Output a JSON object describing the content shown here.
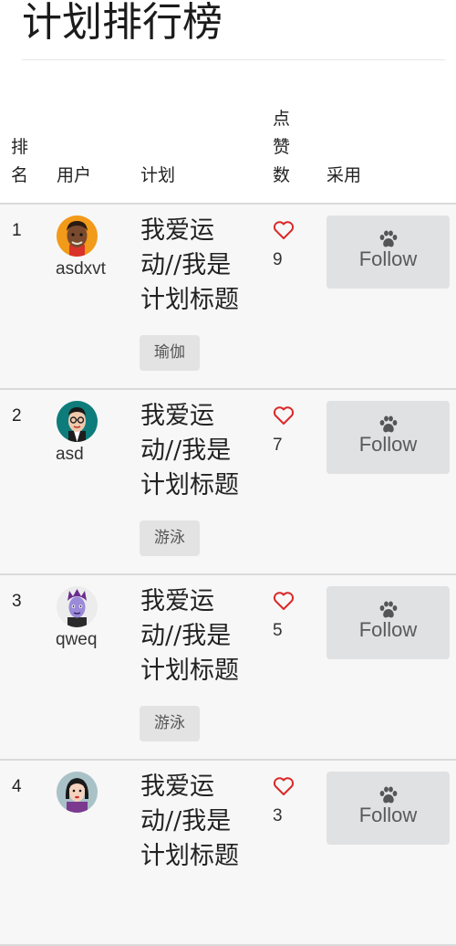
{
  "page": {
    "title": "计划排行榜"
  },
  "table": {
    "headers": {
      "rank": "排名",
      "user": "用户",
      "plan": "计划",
      "likes": "点赞数",
      "adopt": "采用"
    },
    "rows": [
      {
        "rank": "1",
        "username": "asdxvt",
        "avatar_icon": "avatar-dark-skin-icon",
        "plan_title": "我爱运动//我是计划标题",
        "tag": "瑜伽",
        "likes": "9",
        "follow_label": "Follow"
      },
      {
        "rank": "2",
        "username": "asd",
        "avatar_icon": "avatar-glasses-man-icon",
        "plan_title": "我爱运动//我是计划标题",
        "tag": "游泳",
        "likes": "7",
        "follow_label": "Follow"
      },
      {
        "rank": "3",
        "username": "qweq",
        "avatar_icon": "avatar-purple-hair-icon",
        "plan_title": "我爱运动//我是计划标题",
        "tag": "游泳",
        "likes": "5",
        "follow_label": "Follow"
      },
      {
        "rank": "4",
        "username": "",
        "avatar_icon": "avatar-woman-icon",
        "plan_title": "我爱运动//我是计划标题",
        "tag": "",
        "likes": "3",
        "follow_label": "Follow"
      }
    ]
  },
  "colors": {
    "heart": "#db2828",
    "follow_bg": "#e0e1e2",
    "row_bg": "#f7f7f7"
  }
}
